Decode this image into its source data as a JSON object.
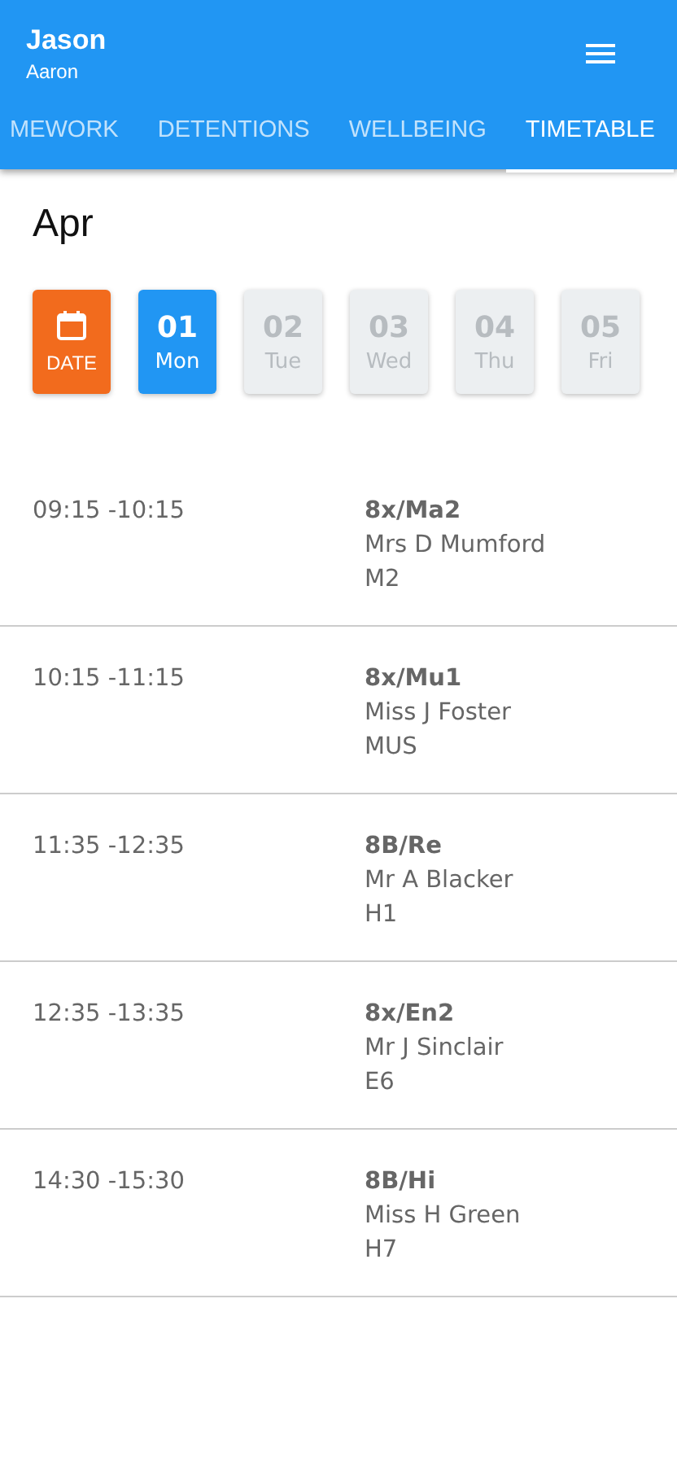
{
  "header": {
    "title": "Jason",
    "subtitle": "Aaron"
  },
  "tabs": [
    {
      "label": "MEWORK",
      "selected": false
    },
    {
      "label": "DETENTIONS",
      "selected": false
    },
    {
      "label": "WELLBEING",
      "selected": false
    },
    {
      "label": "TIMETABLE",
      "selected": true
    }
  ],
  "month": "Apr",
  "date_button": {
    "label": "DATE"
  },
  "days": [
    {
      "number": "01",
      "weekday": "Mon",
      "selected": true
    },
    {
      "number": "02",
      "weekday": "Tue",
      "selected": false
    },
    {
      "number": "03",
      "weekday": "Wed",
      "selected": false
    },
    {
      "number": "04",
      "weekday": "Thu",
      "selected": false
    },
    {
      "number": "05",
      "weekday": "Fri",
      "selected": false
    }
  ],
  "lessons": [
    {
      "time": "09:15 -10:15",
      "class": "8x/Ma2",
      "teacher": "Mrs D Mumford",
      "room": "M2"
    },
    {
      "time": "10:15 -11:15",
      "class": "8x/Mu1",
      "teacher": "Miss J Foster",
      "room": "MUS"
    },
    {
      "time": "11:35 -12:35",
      "class": "8B/Re",
      "teacher": "Mr A Blacker",
      "room": "H1"
    },
    {
      "time": "12:35 -13:35",
      "class": "8x/En2",
      "teacher": "Mr J Sinclair",
      "room": "E6"
    },
    {
      "time": "14:30 -15:30",
      "class": "8B/Hi",
      "teacher": "Miss H Green",
      "room": "H7"
    }
  ]
}
